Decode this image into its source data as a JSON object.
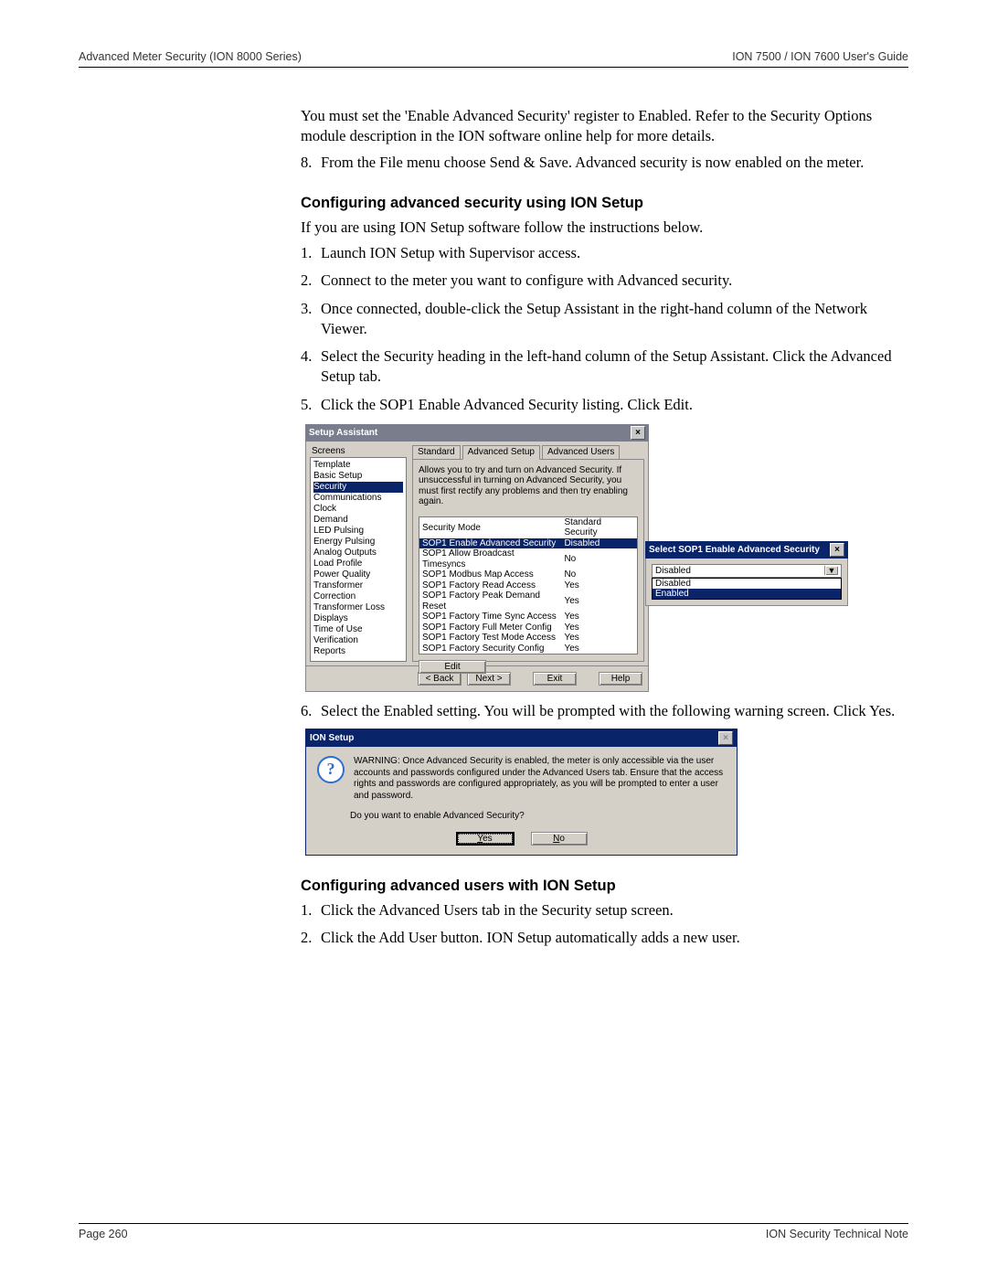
{
  "header": {
    "left": "Advanced Meter Security (ION 8000 Series)",
    "right": "ION 7500 / ION 7600 User's Guide"
  },
  "footer": {
    "left": "Page 260",
    "right": "ION Security Technical Note"
  },
  "intro_para": "You must set the 'Enable Advanced Security' register to Enabled. Refer to the Security Options module description in the ION software online help for more details.",
  "step8": "From the File menu choose Send & Save. Advanced security is now enabled on the meter.",
  "sec1_heading": "Configuring advanced security using ION Setup",
  "sec1_intro": "If you are using ION Setup software follow the instructions below.",
  "sec1_steps": {
    "s1": "Launch ION Setup with Supervisor access.",
    "s2": "Connect to the meter you want to configure with Advanced security.",
    "s3": "Once connected, double-click the Setup Assistant in the right-hand column of the Network Viewer.",
    "s4": "Select the Security heading in the left-hand column of the Setup Assistant. Click the Advanced Setup tab.",
    "s5": "Click the SOP1 Enable Advanced Security listing. Click Edit.",
    "s6": "Select the Enabled setting. You will be prompted with the following warning screen. Click Yes."
  },
  "setup_assistant": {
    "title": "Setup Assistant",
    "screens_label": "Screens",
    "screens": [
      "Template",
      "Basic Setup",
      "Security",
      "Communications",
      "Clock",
      "Demand",
      "LED Pulsing",
      "Energy Pulsing",
      "Analog Outputs",
      "Load Profile",
      "Power Quality",
      "Transformer Correction",
      "Transformer Loss",
      "Displays",
      "Time of Use",
      "Verification",
      "Reports"
    ],
    "selected_screen": "Security",
    "tabs": [
      "Standard",
      "Advanced Setup",
      "Advanced Users"
    ],
    "active_tab": "Advanced Setup",
    "hint": "Allows you to try and turn on Advanced Security.  If unsuccessful in turning on Advanced Security, you must first rectify any problems and then try enabling again.",
    "grid_headers": [
      "Security Mode",
      "Standard Security"
    ],
    "grid_rows": [
      {
        "label": "SOP1 Enable Advanced Security",
        "value": "Disabled",
        "selected": true
      },
      {
        "label": "SOP1 Allow Broadcast Timesyncs",
        "value": "No"
      },
      {
        "label": "SOP1 Modbus Map Access",
        "value": "No"
      },
      {
        "label": "SOP1 Factory Read Access",
        "value": "Yes"
      },
      {
        "label": "SOP1 Factory Peak Demand Reset",
        "value": "Yes"
      },
      {
        "label": "SOP1 Factory Time Sync Access",
        "value": "Yes"
      },
      {
        "label": "SOP1 Factory Full Meter Config",
        "value": "Yes"
      },
      {
        "label": "SOP1 Factory Test Mode Access",
        "value": "Yes"
      },
      {
        "label": "SOP1 Factory Security Config",
        "value": "Yes"
      }
    ],
    "edit_btn": "Edit",
    "buttons": {
      "back": "< Back",
      "next": "Next >",
      "exit": "Exit",
      "help": "Help"
    }
  },
  "popover": {
    "title": "Select SOP1 Enable Advanced Security",
    "combo_value": "Disabled",
    "options": [
      "Disabled",
      "Enabled"
    ],
    "highlighted": "Enabled"
  },
  "warn_dialog": {
    "title": "ION Setup",
    "msg": "WARNING: Once Advanced Security is enabled, the meter is only accessible via the user accounts and passwords configured under the Advanced Users tab.  Ensure that the access rights and passwords are configured appropriately, as you will be prompted to enter a user and password.",
    "prompt": "Do you want to enable Advanced Security?",
    "yes": "Yes",
    "no": "No"
  },
  "sec2_heading": "Configuring advanced users with ION Setup",
  "sec2_steps": {
    "s1": "Click the Advanced Users tab in the Security setup screen.",
    "s2": "Click the Add User button. ION Setup automatically adds a new user."
  }
}
